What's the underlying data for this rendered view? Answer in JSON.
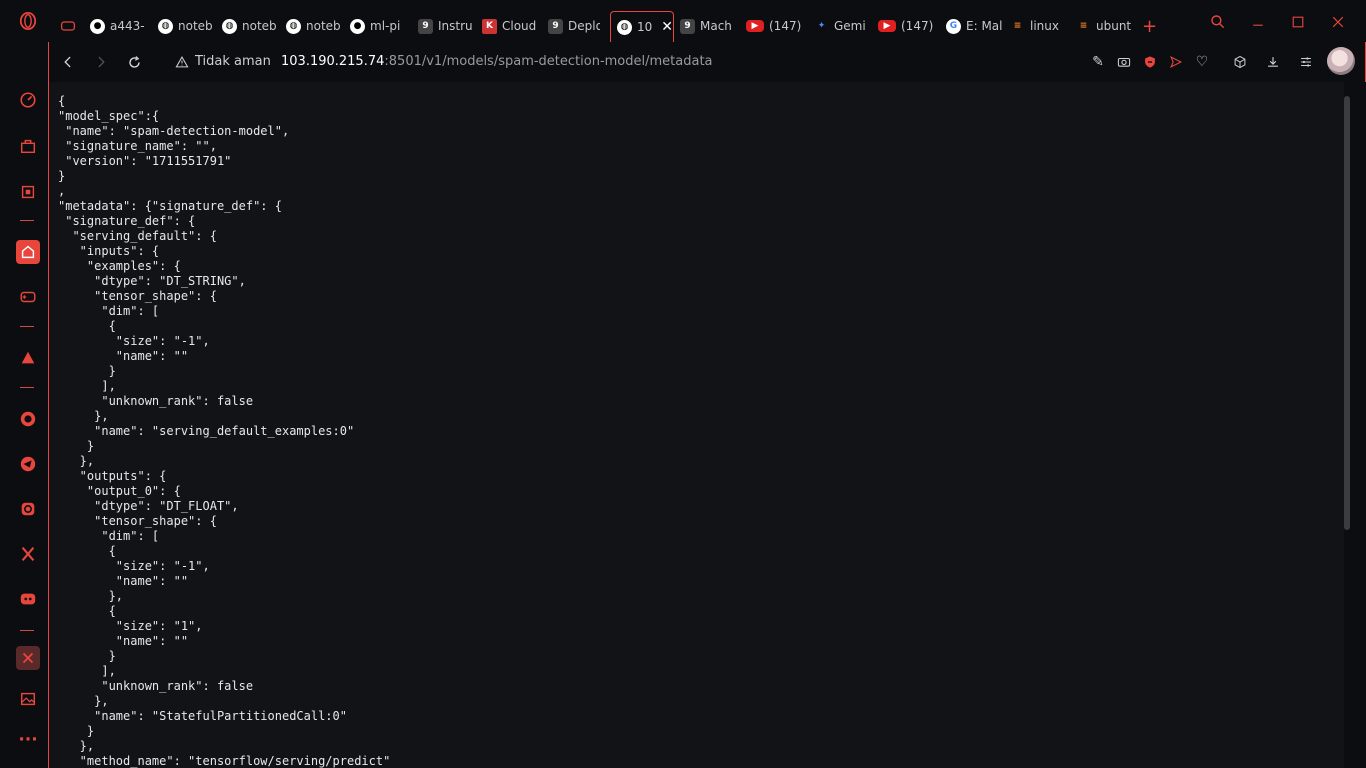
{
  "sidebar": {
    "items": [
      {
        "name": "speed-dial-icon"
      },
      {
        "name": "bag-icon"
      },
      {
        "name": "cpu-icon"
      },
      {
        "name": "home-icon"
      },
      {
        "name": "gamepad-icon"
      },
      {
        "name": "aria-icon"
      },
      {
        "name": "whatsapp-icon"
      },
      {
        "name": "telegram-icon"
      },
      {
        "name": "instagram-icon"
      },
      {
        "name": "x-twitter-icon"
      },
      {
        "name": "discord-icon"
      },
      {
        "name": "sidebar-app-icon"
      },
      {
        "name": "image-icon"
      },
      {
        "name": "more-icon"
      }
    ],
    "more_label": "···"
  },
  "tabs": [
    {
      "label": "a443-",
      "icon": "github-icon"
    },
    {
      "label": "noteb",
      "icon": "globe-icon"
    },
    {
      "label": "noteb",
      "icon": "globe-icon"
    },
    {
      "label": "noteb",
      "icon": "globe-icon"
    },
    {
      "label": "ml-pi",
      "icon": "github-icon"
    },
    {
      "label": "Instru",
      "icon": "g-icon"
    },
    {
      "label": "Cloud",
      "icon": "kube-icon"
    },
    {
      "label": "Deplo",
      "icon": "g-icon"
    },
    {
      "label": "10",
      "icon": "globe-icon",
      "active": true
    },
    {
      "label": "Mach",
      "icon": "g-icon"
    },
    {
      "label": "(147)",
      "icon": "youtube-icon"
    },
    {
      "label": "Gemi",
      "icon": "gemini-icon"
    },
    {
      "label": "(147)",
      "icon": "youtube-icon"
    },
    {
      "label": "E: Mal",
      "icon": "google-icon"
    },
    {
      "label": "linux",
      "icon": "stack-icon"
    },
    {
      "label": "ubunt",
      "icon": "stack-icon"
    }
  ],
  "new_tab_label": "+",
  "addressbar": {
    "security_label": "Tidak aman",
    "url_host": "103.190.215.74",
    "url_path": ":8501/v1/models/spam-detection-model/metadata"
  },
  "json_lines": [
    "{",
    "\"model_spec\":{",
    " \"name\": \"spam-detection-model\",",
    " \"signature_name\": \"\",",
    " \"version\": \"1711551791\"",
    "}",
    ",",
    "\"metadata\": {\"signature_def\": {",
    " \"signature_def\": {",
    "  \"serving_default\": {",
    "   \"inputs\": {",
    "    \"examples\": {",
    "     \"dtype\": \"DT_STRING\",",
    "     \"tensor_shape\": {",
    "      \"dim\": [",
    "       {",
    "        \"size\": \"-1\",",
    "        \"name\": \"\"",
    "       }",
    "      ],",
    "      \"unknown_rank\": false",
    "     },",
    "     \"name\": \"serving_default_examples:0\"",
    "    }",
    "   },",
    "   \"outputs\": {",
    "    \"output_0\": {",
    "     \"dtype\": \"DT_FLOAT\",",
    "     \"tensor_shape\": {",
    "      \"dim\": [",
    "       {",
    "        \"size\": \"-1\",",
    "        \"name\": \"\"",
    "       },",
    "       {",
    "        \"size\": \"1\",",
    "        \"name\": \"\"",
    "       }",
    "      ],",
    "      \"unknown_rank\": false",
    "     },",
    "     \"name\": \"StatefulPartitionedCall:0\"",
    "    }",
    "   },",
    "   \"method_name\": \"tensorflow/serving/predict\""
  ]
}
